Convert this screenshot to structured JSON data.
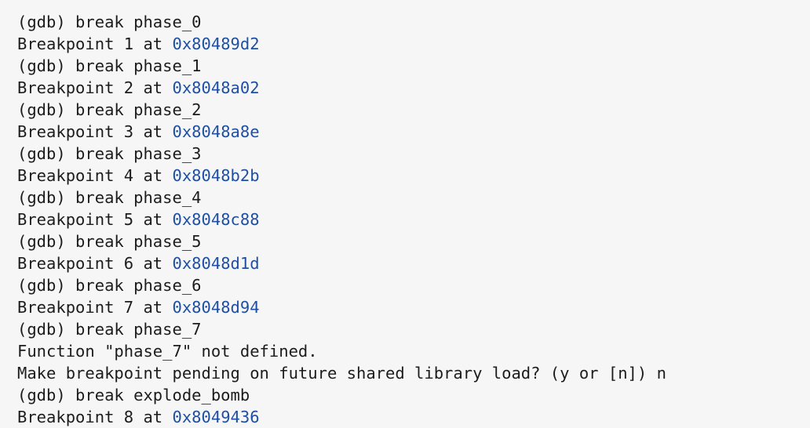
{
  "terminal": {
    "lines": [
      {
        "kind": "cmd",
        "text": "(gdb) break phase_0"
      },
      {
        "kind": "bp",
        "prefix": "Breakpoint 1 at ",
        "address": "0x80489d2"
      },
      {
        "kind": "cmd",
        "text": "(gdb) break phase_1"
      },
      {
        "kind": "bp",
        "prefix": "Breakpoint 2 at ",
        "address": "0x8048a02"
      },
      {
        "kind": "cmd",
        "text": "(gdb) break phase_2"
      },
      {
        "kind": "bp",
        "prefix": "Breakpoint 3 at ",
        "address": "0x8048a8e"
      },
      {
        "kind": "cmd",
        "text": "(gdb) break phase_3"
      },
      {
        "kind": "bp",
        "prefix": "Breakpoint 4 at ",
        "address": "0x8048b2b"
      },
      {
        "kind": "cmd",
        "text": "(gdb) break phase_4"
      },
      {
        "kind": "bp",
        "prefix": "Breakpoint 5 at ",
        "address": "0x8048c88"
      },
      {
        "kind": "cmd",
        "text": "(gdb) break phase_5"
      },
      {
        "kind": "bp",
        "prefix": "Breakpoint 6 at ",
        "address": "0x8048d1d"
      },
      {
        "kind": "cmd",
        "text": "(gdb) break phase_6"
      },
      {
        "kind": "bp",
        "prefix": "Breakpoint 7 at ",
        "address": "0x8048d94"
      },
      {
        "kind": "cmd",
        "text": "(gdb) break phase_7"
      },
      {
        "kind": "msg",
        "text": "Function \"phase_7\" not defined."
      },
      {
        "kind": "msg",
        "text": "Make breakpoint pending on future shared library load? (y or [n]) n"
      },
      {
        "kind": "cmd",
        "text": "(gdb) break explode_bomb"
      },
      {
        "kind": "bp",
        "prefix": "Breakpoint 8 at ",
        "address": "0x8049436"
      }
    ]
  },
  "colors": {
    "background": "#f6f6f6",
    "text": "#1c1c1c",
    "address": "#1f4fa3"
  }
}
